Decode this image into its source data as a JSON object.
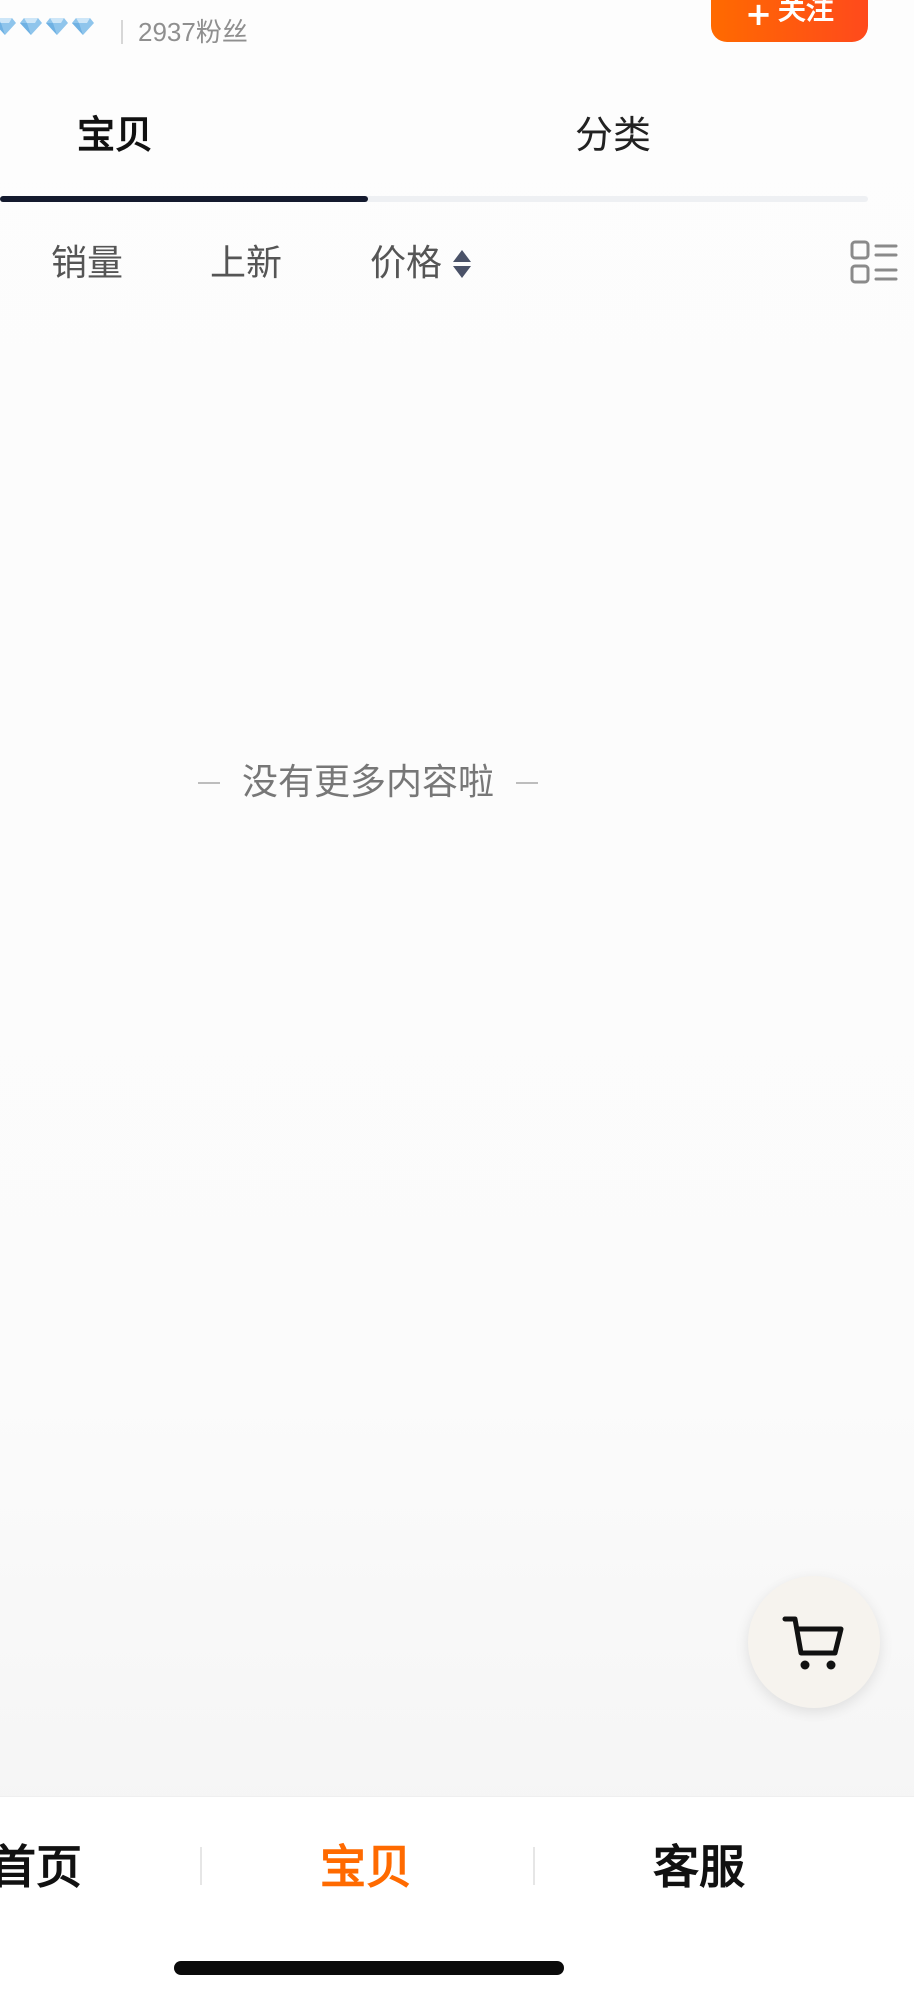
{
  "header": {
    "fans": "2937粉丝",
    "follow_label": "关注",
    "follow_plus": "+",
    "diamond_count": 4,
    "diamond_color": "#8fc5ec"
  },
  "tabs": [
    {
      "label": "宝贝",
      "active": true
    },
    {
      "label": "分类",
      "active": false
    }
  ],
  "sort": {
    "sales": "销量",
    "new": "上新",
    "price": "价格"
  },
  "empty_message": "没有更多内容啦",
  "bottom_nav": {
    "home": "首页",
    "products": "宝贝",
    "service": "客服",
    "active": "宝贝"
  },
  "colors": {
    "accent": "#ff6a00",
    "tab_indicator": "#141a2e",
    "text_dark": "#111111",
    "text_muted": "#777777"
  },
  "icons": {
    "cart": "shopping-cart-icon",
    "layout": "list-layout-icon",
    "sort": "sort-arrows-icon",
    "diamond": "diamond-icon"
  }
}
